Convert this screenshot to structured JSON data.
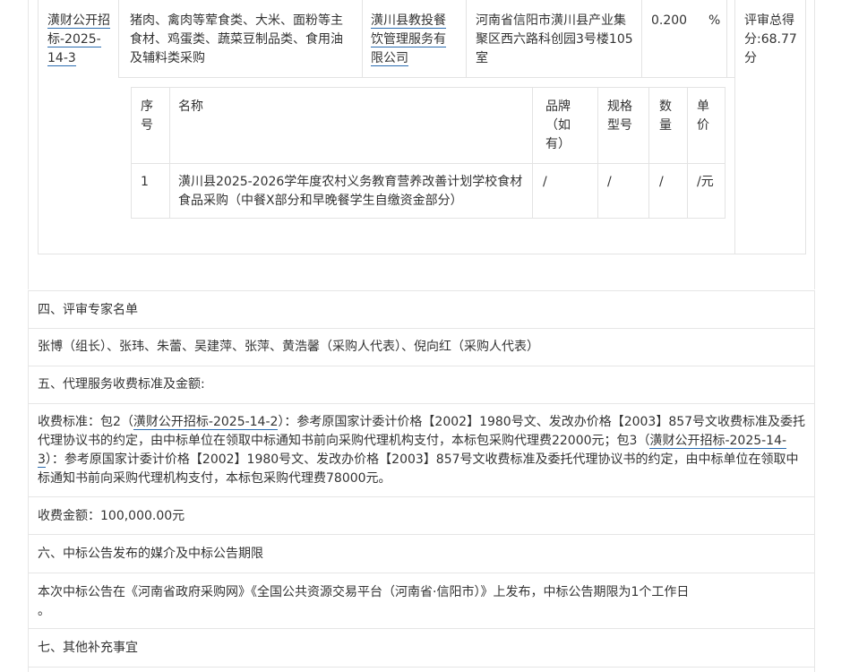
{
  "package": {
    "id_lines": [
      "潢财公开招",
      "标-2025-",
      "14-3"
    ],
    "content_lines": [
      "猪肉、禽肉等荤食类、大米、面粉等主",
      "食材、鸡蛋类、蔬菜豆制品类、食用油",
      "及辅料类采购"
    ],
    "supplier_lines": [
      "潢川县教投餐",
      "饮管理服务有",
      "限公司"
    ],
    "address_lines": [
      "河南省信阳市潢川县产业集",
      "聚区西六路科创园3号楼105",
      "室"
    ],
    "rate": "0.200",
    "rate_unit": "%",
    "score_lines": [
      "评审总得",
      "分:68.77",
      "分"
    ]
  },
  "items_table": {
    "headers": {
      "seq": [
        "序",
        "号"
      ],
      "name": [
        "名称"
      ],
      "brand": [
        "品牌",
        "（如",
        "有）"
      ],
      "spec": [
        "规格",
        "型号"
      ],
      "qty": [
        "数",
        "量"
      ],
      "price": [
        "单",
        "价"
      ]
    },
    "rows": [
      {
        "seq": "1",
        "name_lines": [
          "潢川县2025-2026学年度农村义务教育营养改善计划学校食材",
          "食品采购（中餐X部分和早晚餐学生自缴资金部分）"
        ],
        "brand": "/",
        "spec": "/",
        "qty": "/",
        "price": "/元"
      }
    ]
  },
  "sections": {
    "experts_title": "四、评审专家名单",
    "experts_list": "张博（组长）、张玮、朱蕾、吴建萍、张萍、黄浩馨（采购人代表）、倪向红（采购人代表）",
    "fee_title": "五、代理服务收费标准及金额:",
    "fee_p1_a": "收费标准：包2（",
    "fee_p1_link": "潢财公开招标-2025-14-2",
    "fee_p1_b": "）：参考原国家计委计价格【2002】1980号文、发改办价格【2003】857号文收费标准及委托",
    "fee_p2_a": "代理协议书的约定，由中标单位在领取中标通知书前向采购代理机构支付，本标包采购代理费22000元；包3（",
    "fee_p2_link": "潢财公开招标-2025-14-",
    "fee_p3_link": "3",
    "fee_p3_b": "）：参考原国家计委计价格【2002】1980号文、发改办价格【2003】857号文收费标准及委托代理协议书的约定，由中标单位在领取中",
    "fee_p4": "标通知书前向采购代理机构支付，本标包采购代理费78000元。",
    "fee_amount": "收费金额：100,000.00元",
    "media_title": "六、中标公告发布的媒介及中标公告期限",
    "media_text": "本次中标公告在《河南省政府采购网》《全国公共资源交易平台（河南省·信阳市）》上发布，中标公告期限为1个工作日",
    "media_tail": "。",
    "other_title": "七、其他补充事宜"
  }
}
